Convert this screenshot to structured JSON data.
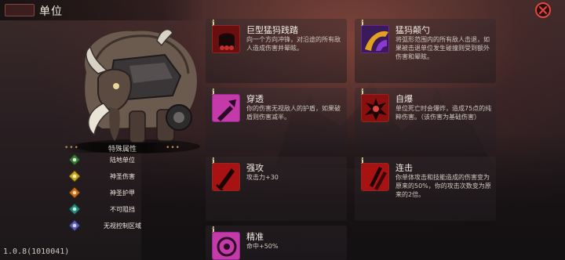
{
  "header": {
    "title": "单位"
  },
  "colors": {
    "accent_red": "#e2473f",
    "panel_gold": "#b8894e",
    "info_yellow": "#f3e7a2"
  },
  "attributes": {
    "title": "特殊属性",
    "items": [
      {
        "label": "陆地单位",
        "icon": "green-diamond-icon",
        "color": "#3a7a38"
      },
      {
        "label": "神圣伤害",
        "icon": "yellow-diamond-icon",
        "color": "#c9a21e"
      },
      {
        "label": "神圣护甲",
        "icon": "orange-diamond-icon",
        "color": "#c96a1a"
      },
      {
        "label": "不可阻挡",
        "icon": "teal-diamond-icon",
        "color": "#2a8a7a"
      },
      {
        "label": "无视控制区域",
        "icon": "purple-diamond-icon",
        "color": "#5a5ab8"
      }
    ]
  },
  "version": "1.0.8(1010041)",
  "skills": [
    {
      "name": "巨型猛犸践踏",
      "desc": "向一个方向冲锋，对沿途的所有敌人造成伤害并晕眩。",
      "icon": "stomp-icon"
    },
    {
      "name": "猛犸颠勺",
      "desc": "将弧形范围内的所有敌人击退，如果被击退单位发生碰撞则受到额外伤害和晕眩。",
      "icon": "sweep-icon"
    },
    {
      "name": "穿透",
      "desc": "你的伤害无视敌人的护盾，如果破盾则伤害减半。",
      "icon": "pierce-icon"
    },
    {
      "name": "自爆",
      "desc": "单位死亡时会爆炸，造成75点的纯粹伤害。（该伤害为基础伤害）",
      "icon": "explode-icon"
    },
    {
      "name": "强攻",
      "desc": "攻击力+30",
      "icon": "strong-attack-icon"
    },
    {
      "name": "连击",
      "desc": "你单体攻击和技能造成的伤害变为原来的50%，你的攻击次数变为原来的2倍。",
      "icon": "combo-icon"
    },
    {
      "name": "精准",
      "desc": "命中+50%",
      "icon": "precision-icon"
    }
  ]
}
